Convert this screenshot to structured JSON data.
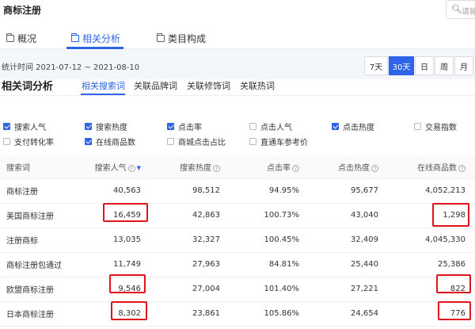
{
  "header": {
    "title": "商标注册",
    "search_placeholder": "请输"
  },
  "nav_tabs": [
    {
      "label": "概况",
      "icon": "folder-icon",
      "active": false
    },
    {
      "label": "相关分析",
      "icon": "folder-icon",
      "active": true
    },
    {
      "label": "类目构成",
      "icon": "folder-icon",
      "active": false
    }
  ],
  "date": {
    "label": "统计时间 2021-07-12 ~ 2021-08-10",
    "ranges": [
      {
        "label": "7天",
        "active": false
      },
      {
        "label": "30天",
        "active": true
      },
      {
        "label": "日",
        "active": false
      },
      {
        "label": "周",
        "active": false
      },
      {
        "label": "月",
        "active": false
      }
    ]
  },
  "section": {
    "title": "相关词分析",
    "subtabs": [
      {
        "label": "相关搜索词",
        "active": true
      },
      {
        "label": "关联品牌词",
        "active": false
      },
      {
        "label": "关联修饰词",
        "active": false
      },
      {
        "label": "关联热词",
        "active": false
      }
    ]
  },
  "metrics": [
    {
      "label": "搜索人气",
      "checked": true
    },
    {
      "label": "搜索热度",
      "checked": true
    },
    {
      "label": "点击率",
      "checked": true
    },
    {
      "label": "点击人气",
      "checked": false
    },
    {
      "label": "点击热度",
      "checked": true
    },
    {
      "label": "交易指数",
      "checked": false
    },
    {
      "label": "支付转化率",
      "checked": false
    },
    {
      "label": "在线商品数",
      "checked": true
    },
    {
      "label": "商城点击占比",
      "checked": false
    },
    {
      "label": "直通车参考价",
      "checked": false
    }
  ],
  "table": {
    "columns": [
      "搜索词",
      "搜索人气",
      "搜索热度",
      "点击率",
      "点击热度",
      "在线商品数"
    ],
    "sorted_column": "搜索人气",
    "rows": [
      [
        "商标注册",
        "40,563",
        "98,512",
        "94.95%",
        "95,677",
        "4,052,213"
      ],
      [
        "美国商标注册",
        "16,459",
        "42,863",
        "100.73%",
        "43,040",
        "1,298"
      ],
      [
        "注册商标",
        "13,035",
        "32,327",
        "100.45%",
        "32,409",
        "4,045,330"
      ],
      [
        "商标注册包通过",
        "11,749",
        "27,963",
        "84.81%",
        "25,440",
        "25,386"
      ],
      [
        "欧盟商标注册",
        "9,546",
        "27,004",
        "101.40%",
        "27,221",
        "822"
      ],
      [
        "日本商标注册",
        "8,302",
        "23,861",
        "105.86%",
        "24,654",
        "776"
      ]
    ]
  },
  "annotation_color": "#e0151b",
  "accent_color": "#2e64e8"
}
